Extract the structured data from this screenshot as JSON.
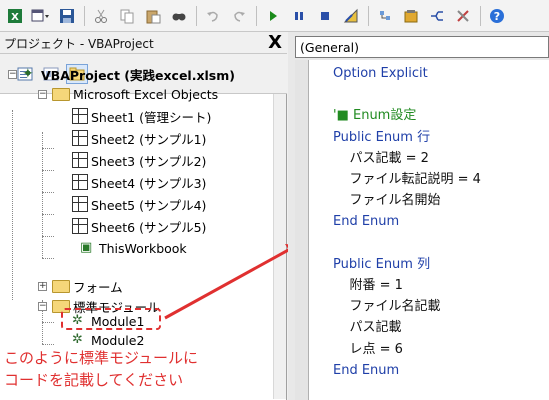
{
  "toolbar": {
    "icons": [
      "excel-icon",
      "insert-userform-icon",
      "save-icon",
      "cut-icon",
      "copy-icon",
      "paste-icon",
      "find-icon",
      "undo-icon",
      "redo-icon",
      "run-icon",
      "break-icon",
      "reset-icon",
      "design-mode-icon",
      "project-explorer-icon",
      "properties-icon",
      "object-browser-icon",
      "toolbox-icon",
      "help-icon"
    ]
  },
  "project_panel": {
    "title": "プロジェクト - VBAProject",
    "close_label": "X",
    "tree": {
      "root": "VBAProject (実践excel.xlsm)",
      "excel_objects": "Microsoft Excel Objects",
      "sheets": [
        "Sheet1 (管理シート)",
        "Sheet2 (サンプル1)",
        "Sheet3 (サンプル2)",
        "Sheet4 (サンプル3)",
        "Sheet5 (サンプル4)",
        "Sheet6 (サンプル5)"
      ],
      "workbook": "ThisWorkbook",
      "forms_folder": "フォーム",
      "modules_folder": "標準モジュール",
      "modules": [
        "Module1",
        "Module2"
      ]
    }
  },
  "annotation": {
    "line1": "このように標準モジュールに",
    "line2": "コードを記載してください",
    "color": "#e03030"
  },
  "code_pane": {
    "object_combo": "(General)",
    "lines": [
      {
        "text": "Option Explicit",
        "style": "kw"
      },
      {
        "text": "",
        "style": "tx"
      },
      {
        "text": "'■ Enum設定",
        "style": "cm"
      },
      {
        "text": "Public Enum 行",
        "style": "kw"
      },
      {
        "text": "  パス記載 = 2",
        "style": "tx"
      },
      {
        "text": "  ファイル転記説明 = 4",
        "style": "tx"
      },
      {
        "text": "  ファイル名開始",
        "style": "tx"
      },
      {
        "text": "End Enum",
        "style": "kw"
      },
      {
        "text": "",
        "style": "tx"
      },
      {
        "text": "Public Enum 列",
        "style": "kw"
      },
      {
        "text": "  附番 = 1",
        "style": "tx"
      },
      {
        "text": "  ファイル名記載",
        "style": "tx"
      },
      {
        "text": "  パス記載",
        "style": "tx"
      },
      {
        "text": "  レ点 = 6",
        "style": "tx"
      },
      {
        "text": "End Enum",
        "style": "kw"
      }
    ]
  }
}
